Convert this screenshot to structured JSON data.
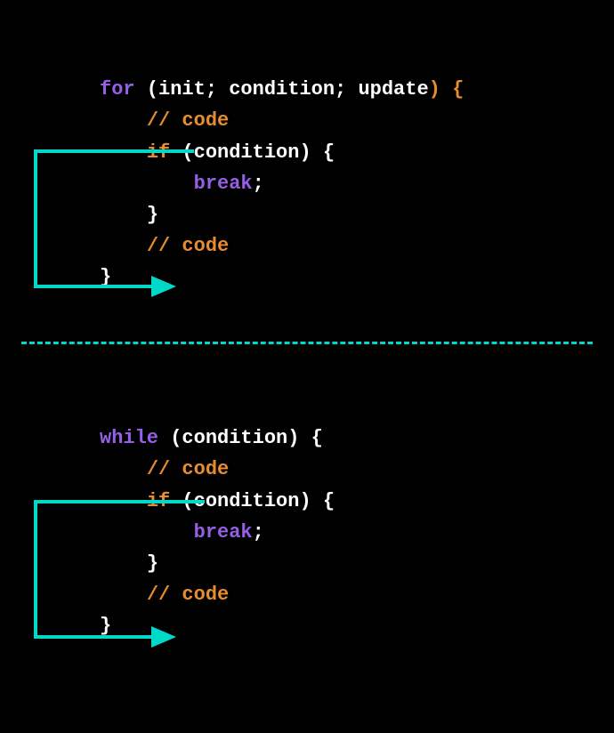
{
  "colors": {
    "keyword_purple": "#9560e6",
    "keyword_orange": "#e88c30",
    "text_white": "#ffffff",
    "arrow_cyan": "#00d8c8",
    "bg": "#000000"
  },
  "for_block": {
    "kw_for": "for",
    "paren_open": " (",
    "init": "init; condition; update",
    "paren_close": ") {",
    "comment1": "// code",
    "kw_if": "if",
    "if_cond": " (condition) {",
    "kw_break": "break",
    "break_semi": ";",
    "if_close": "}",
    "comment2": "// code",
    "for_close": "}"
  },
  "while_block": {
    "kw_while": "while",
    "cond": " (condition) {",
    "comment1": "// code",
    "kw_if": "if",
    "if_cond": " (condition) {",
    "kw_break": "break",
    "break_semi": ";",
    "if_close": "}",
    "comment2": "// code",
    "while_close": "}"
  }
}
